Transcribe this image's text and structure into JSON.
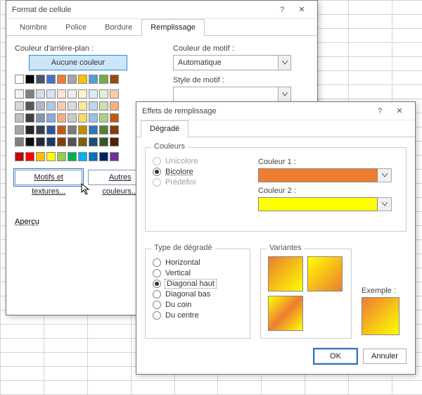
{
  "dlg1": {
    "title": "Format de cellule",
    "tabs": {
      "nombre": "Nombre",
      "police": "Police",
      "bordure": "Bordure",
      "remplissage": "Remplissage"
    },
    "bgColorLabel": "Couleur d'arrière-plan :",
    "noColor": "Aucune couleur",
    "effectsBtn": "Motifs et textures...",
    "moreColorsBtn": "Autres couleurs...",
    "previewLabel": "Aperçu",
    "patternColorLabel": "Couleur de motif :",
    "patternColorValue": "Automatique",
    "patternStyleLabel": "Style de motif :",
    "colors": {
      "row1": [
        "#ffffff",
        "#000000",
        "#44546a",
        "#4472c4",
        "#ed7d31",
        "#a5a5a5",
        "#ffc000",
        "#5b9bd5",
        "#70ad47",
        "#9e480e"
      ],
      "theme": [
        [
          "#f2f2f2",
          "#808080",
          "#d6dce5",
          "#d9e1f2",
          "#fce4d6",
          "#ededed",
          "#fff2cc",
          "#ddebf7",
          "#e2efda",
          "#f8cbad"
        ],
        [
          "#d9d9d9",
          "#595959",
          "#acb9ca",
          "#b4c6e7",
          "#f8cbad",
          "#dbdbdb",
          "#ffe699",
          "#bdd7ee",
          "#c6e0b4",
          "#f4b084"
        ],
        [
          "#bfbfbf",
          "#404040",
          "#8497b0",
          "#8ea9db",
          "#f4b084",
          "#c9c9c9",
          "#ffd966",
          "#9bc2e6",
          "#a9d08e",
          "#c65911"
        ],
        [
          "#a6a6a6",
          "#262626",
          "#333f4f",
          "#305496",
          "#c65911",
          "#7b7b7b",
          "#bf8f00",
          "#2f75b5",
          "#548235",
          "#833c0c"
        ],
        [
          "#808080",
          "#0d0d0d",
          "#222b35",
          "#203764",
          "#833c0c",
          "#525252",
          "#806000",
          "#1f4e78",
          "#375623",
          "#551f01"
        ]
      ],
      "std": [
        "#c00000",
        "#ff0000",
        "#ffc000",
        "#ffff00",
        "#92d050",
        "#00b050",
        "#00b0f0",
        "#0070c0",
        "#002060",
        "#7030a0"
      ]
    }
  },
  "dlg2": {
    "title": "Effets de remplissage",
    "tabDegrade": "Dégradé",
    "grpColors": "Couleurs",
    "unicolore": "Unicolore",
    "bicolore": "Bicolore",
    "predefini": "Prédéfini",
    "color1Label": "Couleur 1 :",
    "color1": "#ed7d31",
    "color2Label": "Couleur 2 :",
    "color2": "#ffff00",
    "grpType": "Type de dégradé",
    "horizontal": "Horizontal",
    "vertical": "Vertical",
    "diagHaut": "Diagonal haut",
    "diagBas": "Diagonal bas",
    "coin": "Du coin",
    "centre": "Du centre",
    "grpVariants": "Variantes",
    "exempleLabel": "Exemple :",
    "ok": "OK",
    "cancel": "Annuler"
  }
}
